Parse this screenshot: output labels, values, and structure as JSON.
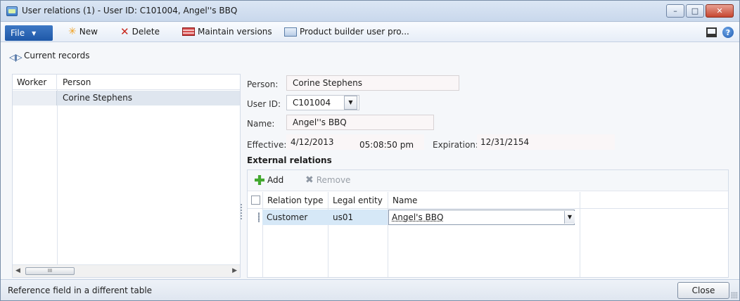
{
  "window": {
    "title": "User relations (1) - User ID: C101004, Angel''s BBQ",
    "controls": {
      "minimize": "–",
      "maximize": "□",
      "close": "✕"
    }
  },
  "actionpane": {
    "file_label": "File",
    "new_label": "New",
    "delete_label": "Delete",
    "maintain_versions_label": "Maintain versions",
    "product_builder_label": "Product builder user pro...",
    "help_glyph": "?"
  },
  "records": {
    "label": "Current records"
  },
  "left_grid": {
    "columns": [
      "Worker",
      "Person"
    ],
    "rows": [
      {
        "worker": "",
        "person": "Corine Stephens"
      }
    ],
    "scroll_thumb": "III"
  },
  "details": {
    "person_label": "Person:",
    "person_value": "Corine Stephens",
    "userid_label": "User ID:",
    "userid_value": "C101004",
    "name_label": "Name:",
    "name_value": "Angel''s BBQ",
    "effective_label": "Effective:",
    "effective_date": "4/12/2013",
    "effective_time": "05:08:50 pm",
    "expiration_label": "Expiration:",
    "expiration_date": "12/31/2154"
  },
  "external_relations": {
    "title": "External relations",
    "add_label": "Add",
    "remove_label": "Remove",
    "columns": [
      "Relation type",
      "Legal entity",
      "Name"
    ],
    "rows": [
      {
        "relation_type": "Customer",
        "legal_entity": "us01",
        "name": "Angel's BBQ"
      }
    ]
  },
  "status": {
    "text": "Reference field in a different table",
    "close_label": "Close"
  },
  "icons": {
    "new": "star-icon",
    "delete": "x-icon",
    "maintain_versions": "versions-icon",
    "product_builder": "builder-icon",
    "layout": "layout-icon",
    "help": "help-icon",
    "records": "split-arrows-icon",
    "add": "plus-icon",
    "remove": "remove-x-icon",
    "dropdown": "chevron-down-icon"
  },
  "colors": {
    "file_button": "#2a64b4",
    "selected_row": "#dfe6ef",
    "selected_cell": "#d6e8f7",
    "readonly_field": "#faf6f7",
    "add_icon": "#43a82f",
    "delete_icon": "#c8291e"
  }
}
